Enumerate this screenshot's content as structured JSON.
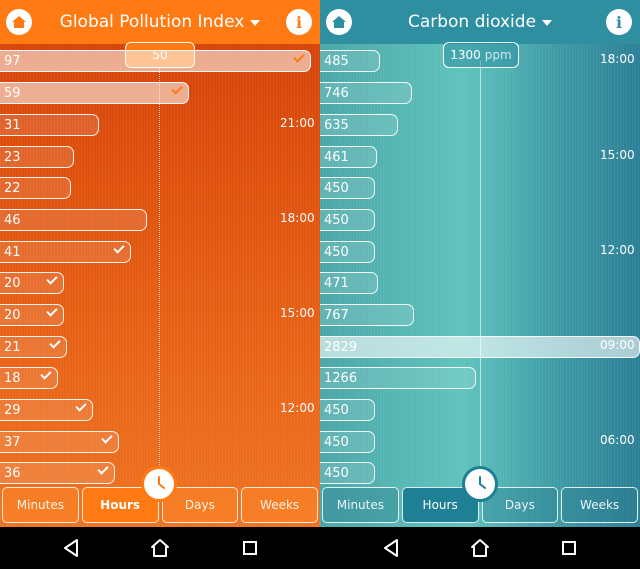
{
  "left": {
    "title": "Global Pollution Index",
    "marker": "50",
    "bars": [
      "97",
      "59",
      "31",
      "23",
      "22",
      "46",
      "41",
      "20",
      "20",
      "21",
      "18",
      "29",
      "37",
      "36"
    ],
    "times": [
      "21:00",
      "18:00",
      "15:00",
      "12:00"
    ],
    "tabs": [
      "Minutes",
      "Hours",
      "Days",
      "Weeks"
    ],
    "active_tab": "Hours",
    "accent": "#ff7a12"
  },
  "right": {
    "title": "Carbon dioxide",
    "marker_value": "1300",
    "marker_unit": "ppm",
    "bars": [
      "485",
      "746",
      "635",
      "461",
      "450",
      "450",
      "450",
      "471",
      "767",
      "2829",
      "1266",
      "450",
      "450",
      "450"
    ],
    "times": [
      "18:00",
      "15:00",
      "12:00",
      "09:00",
      "06:00"
    ],
    "tabs": [
      "Minutes",
      "Hours",
      "Days",
      "Weeks"
    ],
    "active_tab": "Hours",
    "accent": "#2d8fa0"
  },
  "icons": [
    "home-icon",
    "info-icon",
    "caret-down-icon",
    "check-icon",
    "clock-icon",
    "nav-back-icon",
    "nav-home-icon",
    "nav-recents-icon"
  ]
}
